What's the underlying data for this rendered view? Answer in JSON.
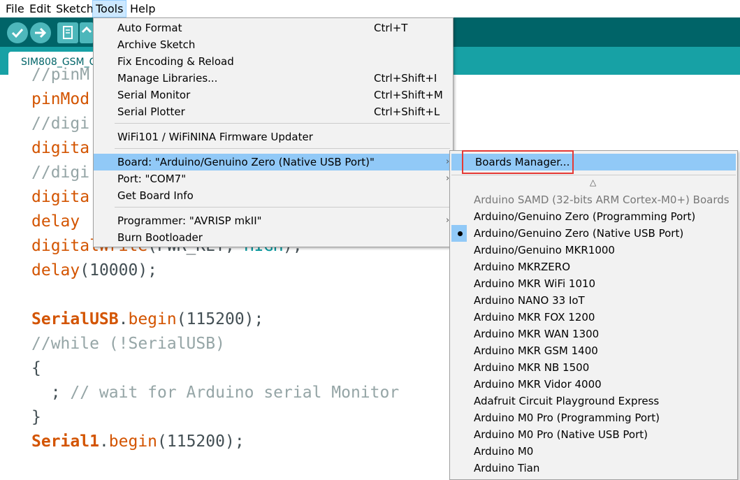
{
  "menubar": {
    "file": "File",
    "edit": "Edit",
    "sketch": "Sketch",
    "tools": "Tools",
    "help": "Help"
  },
  "tab": {
    "label": "SIM808_GSM_C"
  },
  "code": {
    "l1": "//pinM",
    "l2": "pinMod",
    "l3": "//digi",
    "l4": "digita",
    "l5": "//digi",
    "l6": "digita",
    "l7": "delay",
    "l8a": "digitalWrite",
    "l8b": "(PWR_KEY, ",
    "l8c": "HIGH",
    "l8d": ");",
    "l9a": "delay",
    "l9b": "(10000);",
    "l10a": "SerialUSB",
    "l10b": ".",
    "l10c": "begin",
    "l10d": "(115200);",
    "l11": "//while (!SerialUSB)",
    "l12": "{",
    "l13a": "  ; ",
    "l13b": "// wait for Arduino serial Monitor",
    "l14": "}",
    "l15a": "Serial1",
    "l15b": ".",
    "l15c": "begin",
    "l15d": "(115200);"
  },
  "tools_menu": {
    "auto_format": "Auto Format",
    "auto_format_sc": "Ctrl+T",
    "archive": "Archive Sketch",
    "fix_encoding": "Fix Encoding & Reload",
    "manage_libs": "Manage Libraries...",
    "manage_libs_sc": "Ctrl+Shift+I",
    "serial_monitor": "Serial Monitor",
    "serial_monitor_sc": "Ctrl+Shift+M",
    "serial_plotter": "Serial Plotter",
    "serial_plotter_sc": "Ctrl+Shift+L",
    "wifi_updater": "WiFi101 / WiFiNINA Firmware Updater",
    "board": "Board: \"Arduino/Genuino Zero (Native USB Port)\"",
    "port": "Port: \"COM7\"",
    "board_info": "Get Board Info",
    "programmer": "Programmer: \"AVRISP mkII\"",
    "burn_bootloader": "Burn Bootloader",
    "arrow": "›"
  },
  "boards_menu": {
    "boards_manager": "Boards Manager...",
    "scroll_up": "△",
    "section_header": "Arduino SAMD (32-bits ARM Cortex-M0+) Boards",
    "items": [
      "Arduino/Genuino Zero (Programming Port)",
      "Arduino/Genuino Zero (Native USB Port)",
      "Arduino/Genuino MKR1000",
      "Arduino MKRZERO",
      "Arduino MKR WiFi 1010",
      "Arduino NANO 33 IoT",
      "Arduino MKR FOX 1200",
      "Arduino MKR WAN 1300",
      "Arduino MKR GSM 1400",
      "Arduino MKR NB 1500",
      "Arduino MKR Vidor 4000",
      "Adafruit Circuit Playground Express",
      "Arduino M0 Pro (Programming Port)",
      "Arduino M0 Pro (Native USB Port)",
      "Arduino M0",
      "Arduino Tian"
    ],
    "selected_index": 1
  },
  "colors": {
    "toolbar": "#006468",
    "tabbar": "#17a1a5",
    "highlight": "#91c9f7",
    "keyword": "#d35400",
    "comment": "#95a5a6",
    "constant": "#00979c",
    "callout": "#e53935"
  }
}
